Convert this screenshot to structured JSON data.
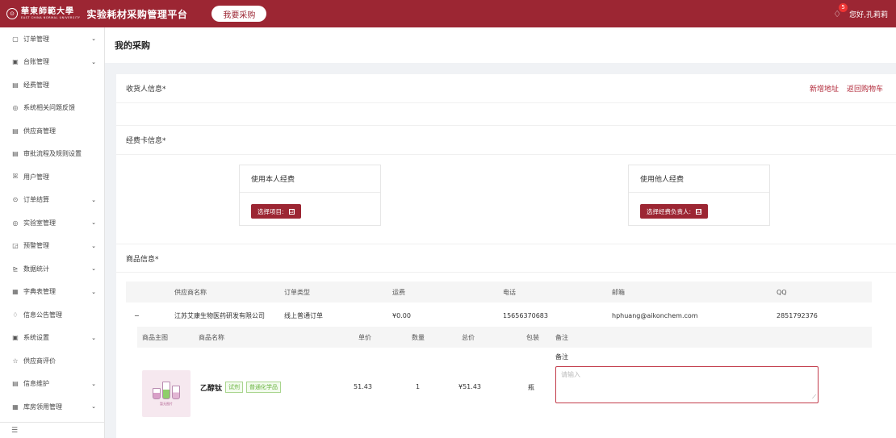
{
  "header": {
    "logo_symbol": "⊙",
    "university_name_cn": "華東師範大學",
    "university_name_en": "EAST CHINA NORMAL UNIVERSITY",
    "app_title": "实验耗材采购管理平台",
    "purchase_button": "我要采购",
    "notification_count": "5",
    "greeting": "您好,孔莉莉"
  },
  "sidebar": {
    "items": [
      {
        "icon": "▢",
        "label": "订单管理",
        "chevron": "⌄"
      },
      {
        "icon": "▣",
        "label": "台账管理",
        "chevron": "⌄"
      },
      {
        "icon": "▤",
        "label": "经费管理",
        "chevron": ""
      },
      {
        "icon": "◎",
        "label": "系统相关问题反馈",
        "chevron": ""
      },
      {
        "icon": "▤",
        "label": "供应商管理",
        "chevron": ""
      },
      {
        "icon": "▤",
        "label": "审批流程及规则设置",
        "chevron": ""
      },
      {
        "icon": "ꕤ",
        "label": "用户管理",
        "chevron": ""
      },
      {
        "icon": "⊙",
        "label": "订单结算",
        "chevron": "⌄"
      },
      {
        "icon": "◎",
        "label": "实验室管理",
        "chevron": "⌄"
      },
      {
        "icon": "◲",
        "label": "预警管理",
        "chevron": "⌄"
      },
      {
        "icon": "⊵",
        "label": "数据统计",
        "chevron": "⌄"
      },
      {
        "icon": "▦",
        "label": "字典表管理",
        "chevron": "⌄"
      },
      {
        "icon": "♢",
        "label": "信息公告管理",
        "chevron": ""
      },
      {
        "icon": "▣",
        "label": "系统设置",
        "chevron": "⌄"
      },
      {
        "icon": "☆",
        "label": "供应商评价",
        "chevron": ""
      },
      {
        "icon": "▤",
        "label": "信息维护",
        "chevron": "⌄"
      },
      {
        "icon": "▦",
        "label": "库房领用管理",
        "chevron": "⌄"
      }
    ],
    "collapse_icon": "☰"
  },
  "page_title": "我的采购",
  "receiver": {
    "title": "收货人信息*",
    "add_address": "新增地址",
    "back_to_cart": "返回购物车"
  },
  "funding": {
    "title": "经费卡信息*",
    "own": {
      "title": "使用本人经费",
      "button": "选择项目:",
      "button_icon": "⊡"
    },
    "other": {
      "title": "使用他人经费",
      "button": "选择经费负责人:",
      "button_icon": "⊡"
    }
  },
  "goods": {
    "title": "商品信息*",
    "supplier_columns": [
      "供应商名称",
      "订单类型",
      "运费",
      "电话",
      "邮箱",
      "QQ"
    ],
    "supplier_row": {
      "toggle": "−",
      "name": "江苏艾康生物医药研发有限公司",
      "order_type": "线上普通订单",
      "freight": "¥0.00",
      "phone": "15656370683",
      "email": "hphuang@aikonchem.com",
      "qq": "2851792376"
    },
    "item_columns": [
      "商品主图",
      "商品名称",
      "单价",
      "数量",
      "总价",
      "包装",
      "备注"
    ],
    "item": {
      "image_caption": "暂无图片",
      "name": "乙醇钛",
      "tag1": "试剂",
      "tag2": "普通化学品",
      "unit_price": "51.43",
      "quantity": "1",
      "total": "¥51.43",
      "package": "瓶",
      "remark_label": "备注",
      "remark_placeholder": "请输入"
    }
  },
  "colors": {
    "brand": "#9c2633",
    "tag_green": "#67b33d"
  }
}
